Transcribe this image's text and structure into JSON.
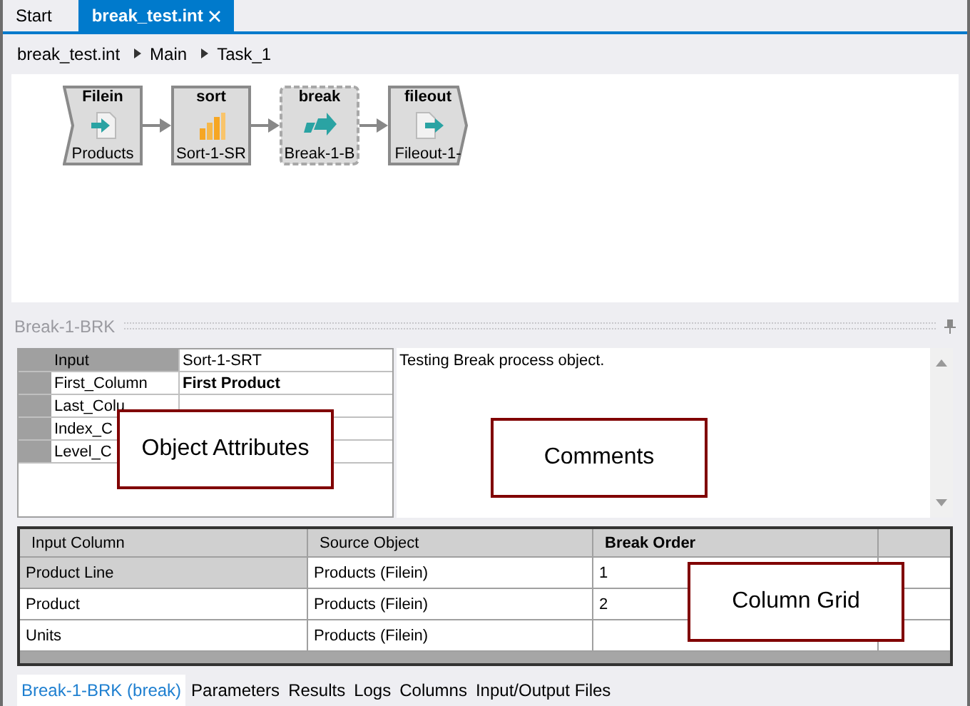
{
  "tabs": [
    {
      "label": "Start",
      "selected": false,
      "closable": false
    },
    {
      "label": "break_test.int",
      "selected": true,
      "closable": true
    }
  ],
  "breadcrumb": [
    "break_test.int",
    "Main",
    "Task_1"
  ],
  "nodes": [
    {
      "kind": "input",
      "title": "Filein",
      "label": "Products",
      "selected": false
    },
    {
      "kind": "process",
      "title": "sort",
      "label": "Sort-1-SR",
      "selected": false
    },
    {
      "kind": "process",
      "title": "break",
      "label": "Break-1-B",
      "selected": true
    },
    {
      "kind": "output",
      "title": "fileout",
      "label": "Fileout-1-",
      "selected": false
    }
  ],
  "panel": {
    "title": "Break-1-BRK",
    "attributes": [
      {
        "name": "Input",
        "value": "Sort-1-SRT",
        "bold": false,
        "selected": true
      },
      {
        "name": "First_Column",
        "value": "First Product",
        "bold": true,
        "selected": false
      },
      {
        "name": "Last_Colu",
        "selected": false
      },
      {
        "name": "Index_C",
        "selected": false
      },
      {
        "name": "Level_C",
        "selected": false
      }
    ],
    "comment": "Testing Break process object.",
    "grid": {
      "columns": [
        "Input Column",
        "Source Object",
        "Break Order"
      ],
      "rows": [
        {
          "cells": [
            "Product Line",
            "Products (Filein)",
            "1"
          ],
          "selected": true
        },
        {
          "cells": [
            "Product",
            "Products (Filein)",
            "2"
          ],
          "selected": false
        },
        {
          "cells": [
            "Units",
            "Products (Filein)",
            ""
          ],
          "selected": false
        }
      ]
    }
  },
  "callouts": [
    "Object Attributes",
    "Comments",
    "Column Grid"
  ],
  "bottom_tabs": [
    {
      "label": "Break-1-BRK (break)",
      "selected": true
    },
    {
      "label": "Parameters",
      "selected": false
    },
    {
      "label": "Results",
      "selected": false
    },
    {
      "label": "Logs",
      "selected": false
    },
    {
      "label": "Columns",
      "selected": false
    },
    {
      "label": "Input/Output Files",
      "selected": false
    }
  ]
}
